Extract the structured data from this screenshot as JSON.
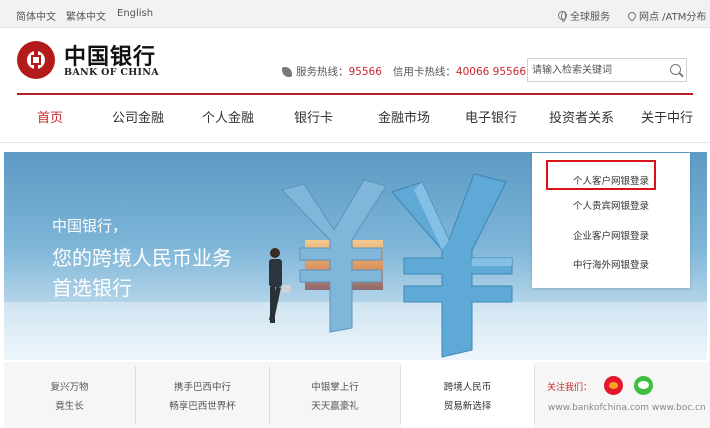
{
  "topbar": {
    "languages": [
      "简体中文",
      "繁体中文",
      "English"
    ],
    "global_service": "全球服务",
    "branches_atm": "网点 /ATM分布"
  },
  "header": {
    "brand_cn": "中国银行",
    "brand_en": "BANK OF CHINA",
    "service_hotline_label": "服务热线：",
    "service_hotline_number": "95566",
    "card_hotline_label": "信用卡热线：",
    "card_hotline_number": "40066 95566",
    "search_placeholder": "请输入检索关键词"
  },
  "nav": {
    "items": [
      {
        "label": "首页",
        "active": true
      },
      {
        "label": "公司金融"
      },
      {
        "label": "个人金融"
      },
      {
        "label": "银行卡"
      },
      {
        "label": "金融市场"
      },
      {
        "label": "电子银行"
      },
      {
        "label": "投资者关系"
      },
      {
        "label": "关于中行"
      }
    ]
  },
  "banner": {
    "line1": "中国银行，",
    "line2": "您的跨境人民币业务",
    "line3": "首选银行"
  },
  "login_menu": {
    "items": [
      "个人客户网银登录",
      "个人贵宾网银登录",
      "企业客户网银登录",
      "中行海外网银登录"
    ],
    "highlighted_index": 0
  },
  "bottom_strip": {
    "cells": [
      {
        "line1": "复兴万物",
        "line2": "竟生长"
      },
      {
        "line1": "携手巴西中行",
        "line2": "畅享巴西世界杯"
      },
      {
        "line1": "中银掌上行",
        "line2": "天天赢豪礼"
      },
      {
        "line1": "跨境人民币",
        "line2": "贸易新选择"
      }
    ],
    "follow_label": "关注我们：",
    "urls": "www.bankofchina.com    www.boc.cn"
  },
  "colors": {
    "brand_red": "#b51e24",
    "highlight_red": "#d8141a"
  }
}
